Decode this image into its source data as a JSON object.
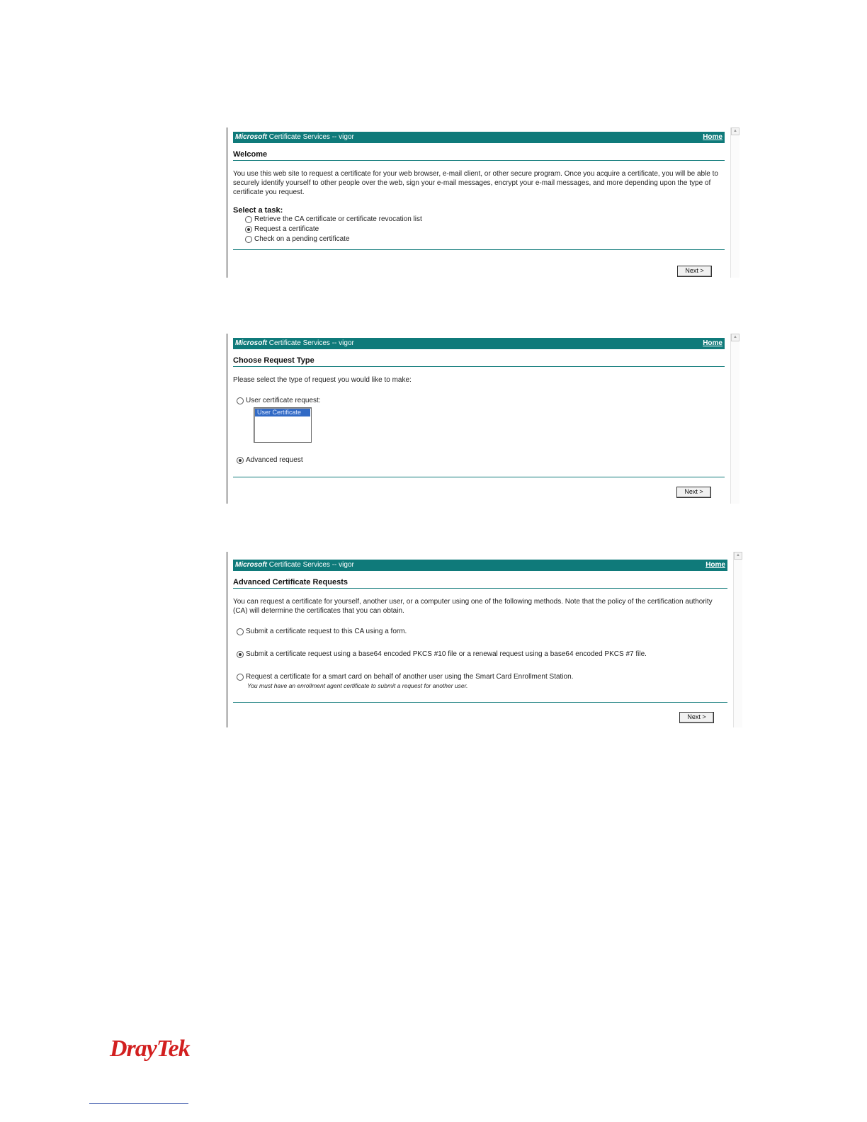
{
  "header": {
    "ms": "Microsoft",
    "service": "Certificate Services",
    "sep": "--",
    "ca_name": "vigor",
    "home": "Home"
  },
  "welcome": {
    "title": "Welcome",
    "body": "You use this web site to request a certificate for your web browser, e-mail client, or other secure program. Once you acquire a certificate, you will be able to securely identify yourself to other people over the web, sign your e-mail messages, encrypt your e-mail messages, and more depending upon the type of certificate you request.",
    "task_title": "Select a task:",
    "options": [
      "Retrieve the CA certificate or certificate revocation list",
      "Request a certificate",
      "Check on a pending certificate"
    ],
    "selected": 1,
    "next": "Next >"
  },
  "request_type": {
    "title": "Choose Request Type",
    "body": "Please select the type of request you would like to make:",
    "user_option": "User certificate request:",
    "list_item": "User Certificate",
    "advanced_option": "Advanced request",
    "selected": "advanced",
    "next": "Next >"
  },
  "advanced": {
    "title": "Advanced Certificate Requests",
    "body": "You can request a certificate for yourself, another user, or a computer using one of the following methods. Note that the policy of the certification authority (CA) will determine the certificates that you can obtain.",
    "options": [
      "Submit a certificate request to this CA using a form.",
      "Submit a certificate request using a base64 encoded PKCS #10 file or a renewal request using a base64 encoded PKCS #7 file.",
      "Request a certificate for a smart card on behalf of another user using the Smart Card Enrollment Station."
    ],
    "note": "You must have an enrollment agent certificate to submit a request for another user.",
    "selected": 1,
    "next": "Next >"
  },
  "brand": {
    "logo": "DrayTek",
    "accent": "#0f7a7a",
    "logo_color": "#d21f1f"
  }
}
